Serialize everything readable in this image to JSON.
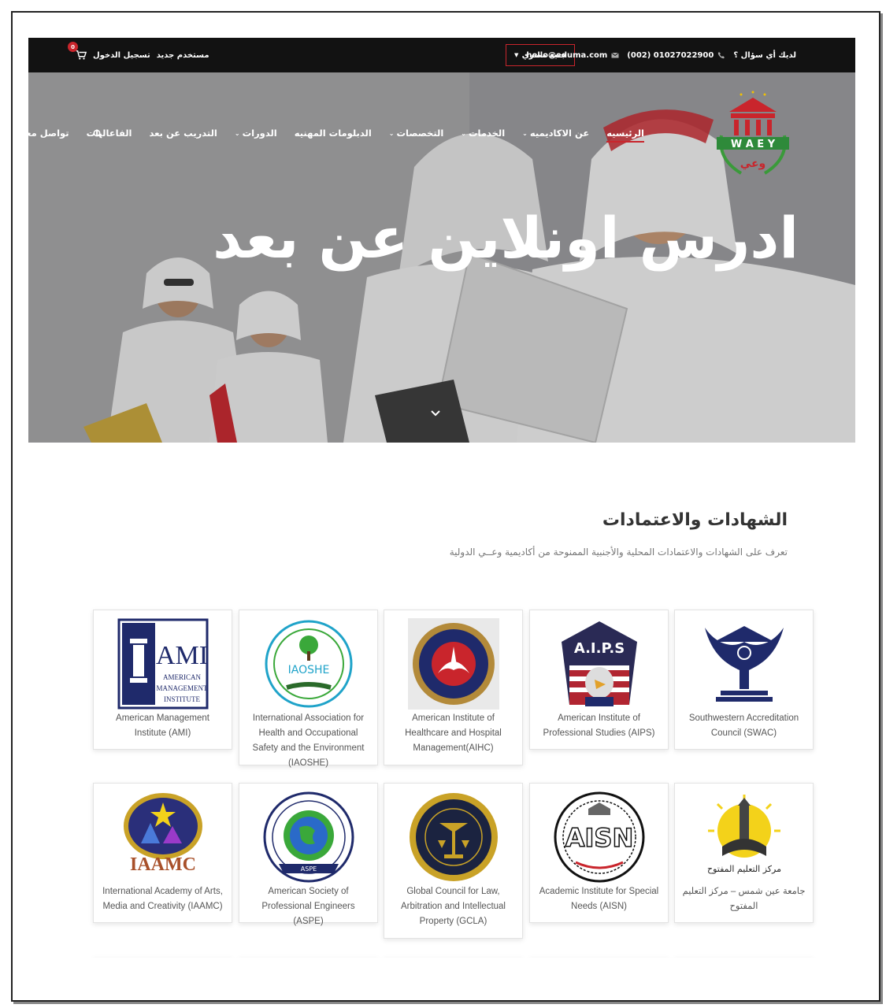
{
  "topbar": {
    "cart_count": "0",
    "login": "تسجيل الدخول",
    "register": "مستخدم جديد",
    "question": "لديك أي سؤال ؟",
    "phone": "(002) 01027022900",
    "email": "hello@eduma.com",
    "currency": "جنيه مصري"
  },
  "logo": {
    "text": "W A E Y",
    "sub": "وعي"
  },
  "nav": {
    "items": [
      {
        "label": "الرئيسيه",
        "dropdown": false,
        "active": true
      },
      {
        "label": "عن الاكاديميه",
        "dropdown": true
      },
      {
        "label": "الخدمات",
        "dropdown": true
      },
      {
        "label": "التخصصات",
        "dropdown": true
      },
      {
        "label": "الدبلومات المهنيه",
        "dropdown": false
      },
      {
        "label": "الدورات",
        "dropdown": true
      },
      {
        "label": "التدريب عن بعد",
        "dropdown": false
      },
      {
        "label": "الفاعاليات",
        "dropdown": false
      },
      {
        "label": "تواصل معنا",
        "dropdown": false
      }
    ]
  },
  "hero": {
    "title": "ادرس اونلاين عن بعد"
  },
  "section": {
    "title": "الشهادات والاعتمادات",
    "subtitle": "تعرف على الشهادات والاعتمادات المحلية والأجنبية الممنوحة من أكاديمية وعــي الدولية"
  },
  "accreditations": [
    {
      "name": "Southwestern Accreditation Council (SWAC)",
      "icon": "eagle-logo-icon"
    },
    {
      "name": "American Institute of Professional Studies (AIPS)",
      "icon": "aips-logo-icon"
    },
    {
      "name": "American Institute of Healthcare and Hospital Management(AIHC)",
      "icon": "aihc-logo-icon"
    },
    {
      "name": "International Association for Health and Occupational Safety and the Environment (IAOSHE)",
      "icon": "iaoshe-logo-icon"
    },
    {
      "name": "American Management Institute (AMI)",
      "icon": "ami-logo-icon"
    },
    {
      "name": "جامعة عين شمس – مركز التعليم المفتوح",
      "icon": "ain-shams-logo-icon",
      "logo_caption": "مركز التعليم المفتوح"
    },
    {
      "name": "Academic Institute for Special Needs (AISN)",
      "icon": "aisn-logo-icon"
    },
    {
      "name": "Global Council for Law, Arbitration and Intellectual Property (GCLA)",
      "icon": "gcla-logo-icon"
    },
    {
      "name": "American Society of Professional Engineers (ASPE)",
      "icon": "aspe-logo-icon"
    },
    {
      "name": "International Academy of Arts, Media and Creativity (IAAMC)",
      "icon": "iaamc-logo-icon",
      "logo_caption": "IAAMC"
    }
  ],
  "colors": {
    "accent": "#c9252c",
    "topbar": "#121212",
    "navy": "#1f2a6b",
    "gold": "#c9a227"
  }
}
